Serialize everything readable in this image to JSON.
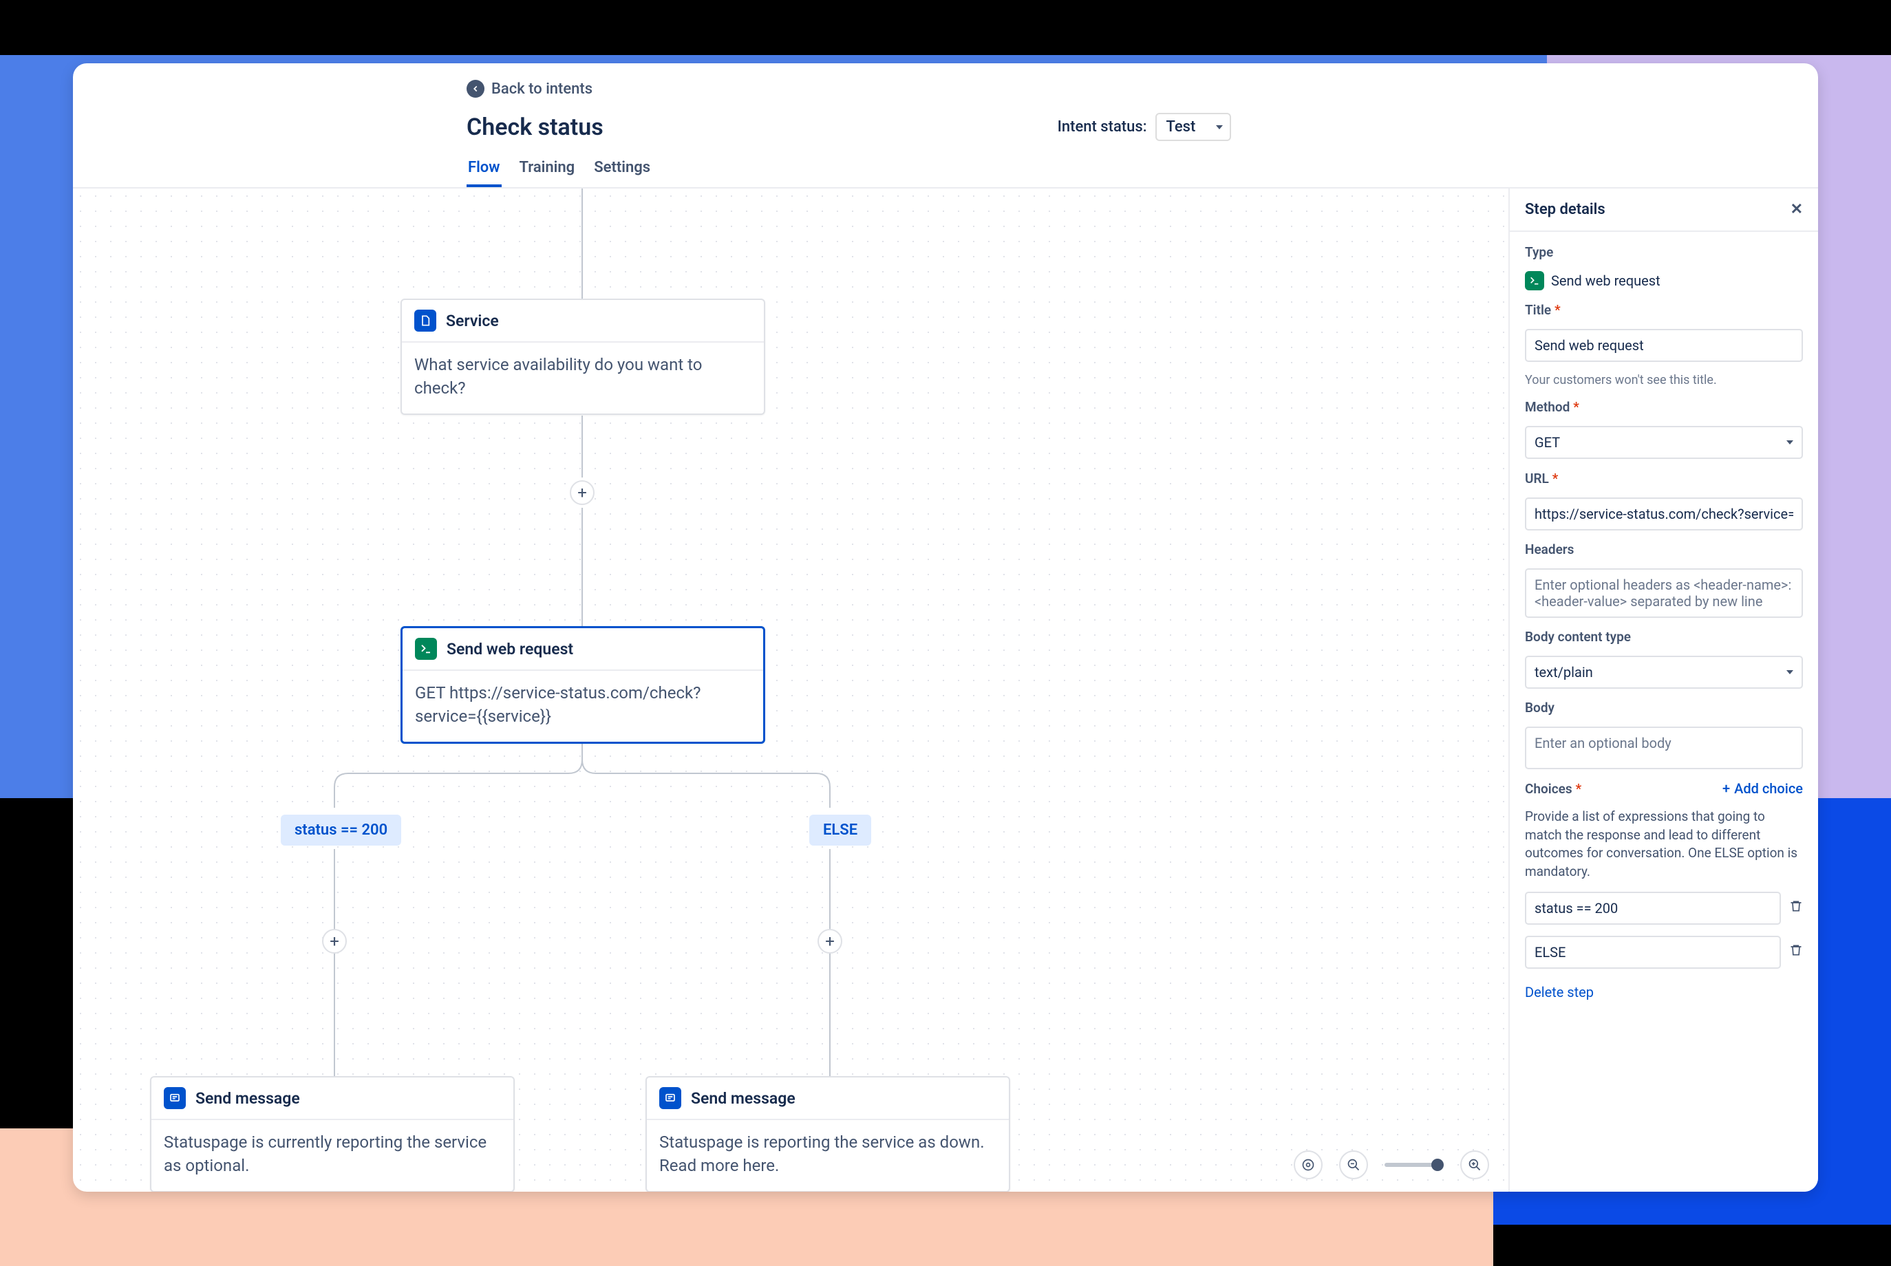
{
  "header": {
    "back_label": "Back to intents",
    "title": "Check status",
    "intent_status_label": "Intent status:",
    "intent_status_value": "Test",
    "tabs": [
      "Flow",
      "Training",
      "Settings"
    ],
    "active_tab": 0
  },
  "nodes": {
    "service": {
      "title": "Service",
      "body": "What service availability do you want to check?"
    },
    "web_request": {
      "title": "Send web request",
      "body": "GET https://service-status.com/check?service={{service}}"
    },
    "msg_left": {
      "title": "Send message",
      "body": "Statuspage is currently reporting the service as optional."
    },
    "msg_right": {
      "title": "Send message",
      "body": "Statuspage is reporting the service as down. Read more here."
    }
  },
  "branches": {
    "left": "status == 200",
    "right": "ELSE"
  },
  "panel": {
    "title": "Step details",
    "type_label": "Type",
    "type_value": "Send web request",
    "title_field_label": "Title",
    "title_field_value": "Send web request",
    "title_hint": "Your customers won't see this title.",
    "method_label": "Method",
    "method_value": "GET",
    "url_label": "URL",
    "url_value": "https://service-status.com/check?service={{service}}",
    "headers_label": "Headers",
    "headers_placeholder": "Enter optional headers as <header-name>:<header-value> separated by new line",
    "body_type_label": "Body content type",
    "body_type_value": "text/plain",
    "body_label": "Body",
    "body_placeholder": "Enter an optional body",
    "choices_label": "Choices",
    "add_choice_label": "Add choice",
    "choices_desc": "Provide a list of expressions that going to match the response and lead to different outcomes for conversation. One ELSE option is mandatory.",
    "choices": [
      "status == 200",
      "ELSE"
    ],
    "delete_label": "Delete step"
  }
}
